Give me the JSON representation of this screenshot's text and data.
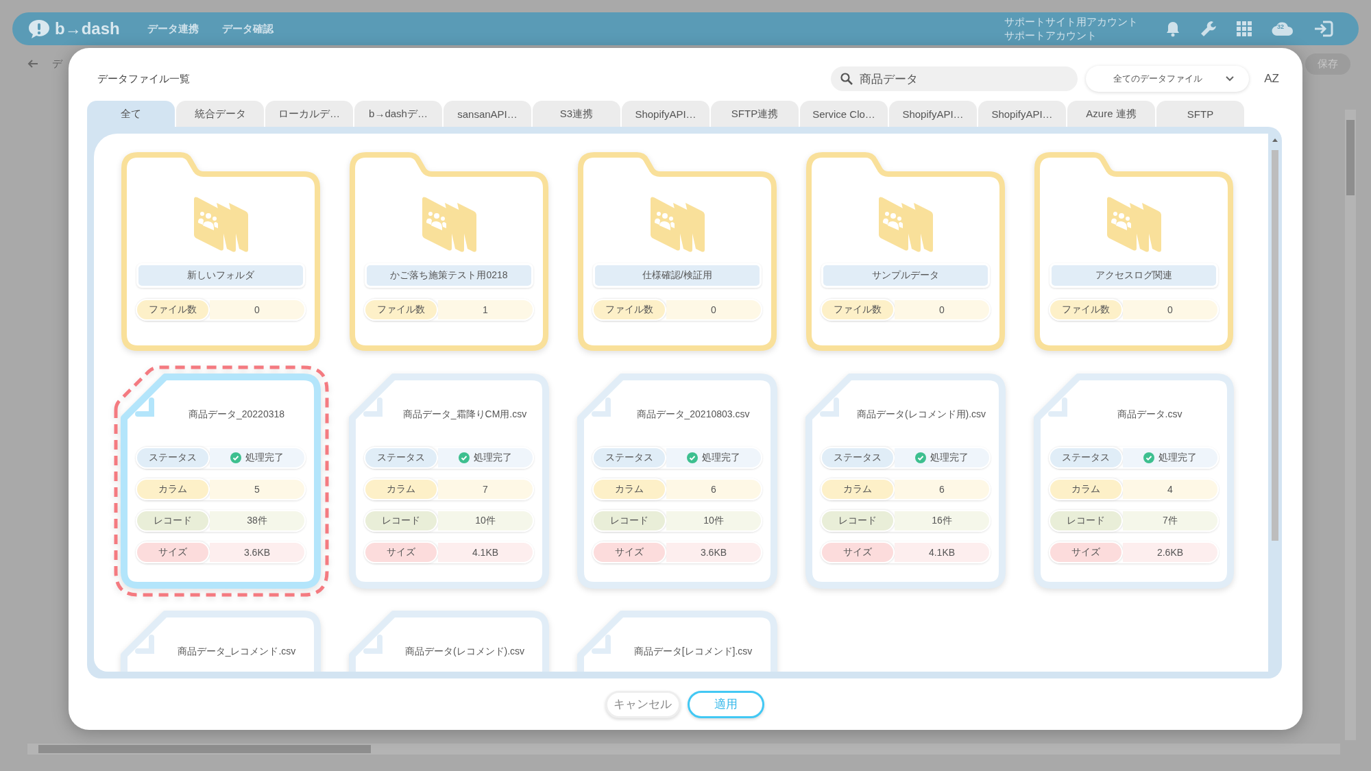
{
  "app_header": {
    "logo": "b→dash",
    "nav": [
      "データ連携",
      "データ確認"
    ],
    "account": [
      "サポートサイト用アカウント",
      "サポートアカウント"
    ],
    "chat_badge": "32"
  },
  "background_page": {
    "breadcrumb": "デ",
    "save_button": "保存"
  },
  "dialog": {
    "title": "データファイル一覧",
    "search": {
      "value": "商品データ"
    },
    "filter": "全てのデータファイル",
    "sort_button": "AZ",
    "tabs": [
      {
        "label": "全て",
        "selected": true
      },
      {
        "label": "統合データ",
        "selected": false
      },
      {
        "label": "ローカルデ…",
        "selected": false
      },
      {
        "label": "b→dashデ…",
        "selected": false
      },
      {
        "label": "sansanAPI…",
        "selected": false
      },
      {
        "label": "S3連携",
        "selected": false
      },
      {
        "label": "ShopifyAPI…",
        "selected": false
      },
      {
        "label": "SFTP連携",
        "selected": false
      },
      {
        "label": "Service Clo…",
        "selected": false
      },
      {
        "label": "ShopifyAPI…",
        "selected": false
      },
      {
        "label": "ShopifyAPI…",
        "selected": false
      },
      {
        "label": "Azure 連携",
        "selected": false
      },
      {
        "label": "SFTP",
        "selected": false
      }
    ],
    "items": [
      {
        "kind": "folder",
        "name": "新しいフォルダ",
        "selected": false,
        "count_label": "ファイル数",
        "count": "0"
      },
      {
        "kind": "folder",
        "name": "かご落ち施策テスト用0218",
        "selected": false,
        "count_label": "ファイル数",
        "count": "1"
      },
      {
        "kind": "folder",
        "name": "仕様確認/検証用",
        "selected": false,
        "count_label": "ファイル数",
        "count": "0"
      },
      {
        "kind": "folder",
        "name": "サンプルデータ",
        "selected": false,
        "count_label": "ファイル数",
        "count": "0"
      },
      {
        "kind": "folder",
        "name": "アクセスログ関連",
        "selected": false,
        "count_label": "ファイル数",
        "count": "0"
      },
      {
        "kind": "file",
        "name": "商品データ_20220318",
        "selected": true,
        "stats": [
          {
            "kind": "status",
            "label": "ステータス",
            "value": "処理完了"
          },
          {
            "kind": "columns",
            "label": "カラム",
            "value": "5"
          },
          {
            "kind": "records",
            "label": "レコード",
            "value": "38件"
          },
          {
            "kind": "size",
            "label": "サイズ",
            "value": "3.6KB"
          }
        ]
      },
      {
        "kind": "file",
        "name": "商品データ_霜降りCM用.csv",
        "selected": false,
        "stats": [
          {
            "kind": "status",
            "label": "ステータス",
            "value": "処理完了"
          },
          {
            "kind": "columns",
            "label": "カラム",
            "value": "7"
          },
          {
            "kind": "records",
            "label": "レコード",
            "value": "10件"
          },
          {
            "kind": "size",
            "label": "サイズ",
            "value": "4.1KB"
          }
        ]
      },
      {
        "kind": "file",
        "name": "商品データ_20210803.csv",
        "selected": false,
        "stats": [
          {
            "kind": "status",
            "label": "ステータス",
            "value": "処理完了"
          },
          {
            "kind": "columns",
            "label": "カラム",
            "value": "6"
          },
          {
            "kind": "records",
            "label": "レコード",
            "value": "10件"
          },
          {
            "kind": "size",
            "label": "サイズ",
            "value": "3.6KB"
          }
        ]
      },
      {
        "kind": "file",
        "name": "商品データ(レコメンド用).csv",
        "selected": false,
        "stats": [
          {
            "kind": "status",
            "label": "ステータス",
            "value": "処理完了"
          },
          {
            "kind": "columns",
            "label": "カラム",
            "value": "6"
          },
          {
            "kind": "records",
            "label": "レコード",
            "value": "16件"
          },
          {
            "kind": "size",
            "label": "サイズ",
            "value": "4.1KB"
          }
        ]
      },
      {
        "kind": "file",
        "name": "商品データ.csv",
        "selected": false,
        "stats": [
          {
            "kind": "status",
            "label": "ステータス",
            "value": "処理完了"
          },
          {
            "kind": "columns",
            "label": "カラム",
            "value": "4"
          },
          {
            "kind": "records",
            "label": "レコード",
            "value": "7件"
          },
          {
            "kind": "size",
            "label": "サイズ",
            "value": "2.6KB"
          }
        ]
      },
      {
        "kind": "file",
        "name": "商品データ_レコメンド.csv",
        "selected": false
      },
      {
        "kind": "file",
        "name": "商品データ(レコメンド).csv",
        "selected": false
      },
      {
        "kind": "file",
        "name": "商品データ[レコメンド].csv",
        "selected": false
      }
    ],
    "buttons": [
      {
        "kind": "cancel",
        "label": "キャンセル"
      },
      {
        "kind": "apply",
        "label": "適用"
      }
    ]
  }
}
